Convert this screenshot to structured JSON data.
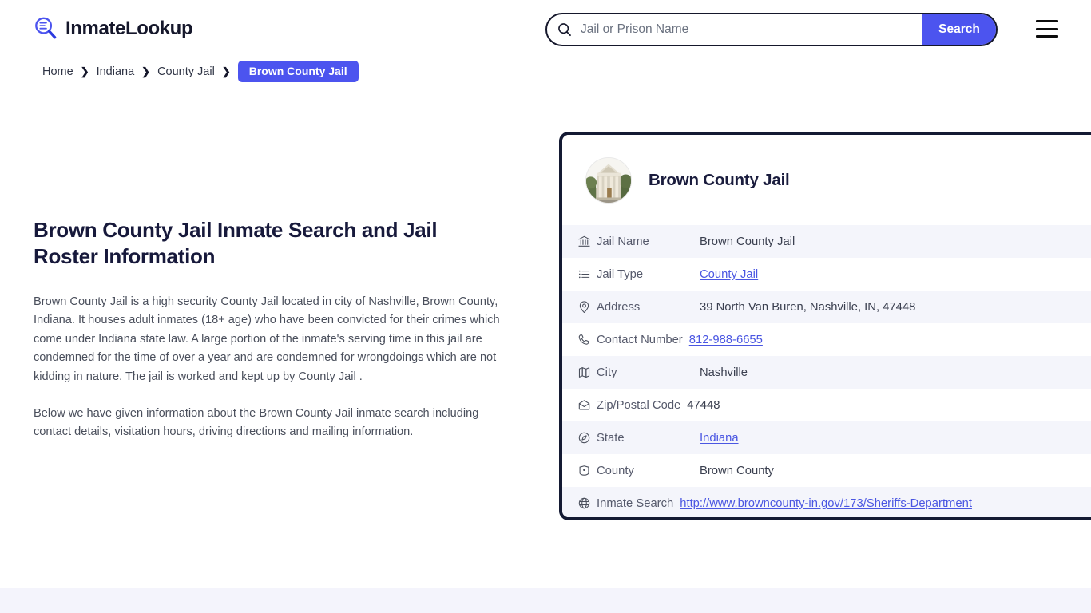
{
  "header": {
    "logo_text": "InmateLookup",
    "logo_icon": "magnifier-list-icon",
    "search": {
      "placeholder": "Jail or Prison Name",
      "value": "",
      "icon": "search-icon",
      "button_label": "Search"
    },
    "menu_icon": "hamburger-menu-icon"
  },
  "breadcrumb": {
    "items": [
      {
        "label": "Home",
        "current": false
      },
      {
        "label": "Indiana",
        "current": false
      },
      {
        "label": "County Jail",
        "current": false
      },
      {
        "label": "Brown County Jail",
        "current": true
      }
    ],
    "separator": "❯"
  },
  "main": {
    "title": "Brown County Jail Inmate Search and Jail Roster Information",
    "paragraphs": [
      "Brown County Jail is a high security County Jail located in city of Nashville, Brown County, Indiana. It houses adult inmates (18+ age) who have been convicted for their crimes which come under Indiana state law. A large portion of the inmate's serving time in this jail are condemned for the time of over a year and are condemned for wrongdoings which are not kidding in nature. The jail is worked and kept up by County Jail .",
      "Below we have given information about the Brown County Jail inmate search including contact details, visitation hours, driving directions and mailing information."
    ]
  },
  "card": {
    "avatar_icon": "courthouse-photo",
    "title": "Brown County Jail",
    "rows": [
      {
        "icon": "bank-icon",
        "label": "Jail Name",
        "value": "Brown County Jail",
        "link": false
      },
      {
        "icon": "list-icon",
        "label": "Jail Type",
        "value": "County Jail",
        "link": true
      },
      {
        "icon": "location-icon",
        "label": "Address",
        "value": "39 North Van Buren, Nashville, IN, 47448",
        "link": false
      },
      {
        "icon": "phone-icon",
        "label": "Contact Number",
        "value": "812-988-6655",
        "link": true
      },
      {
        "icon": "map-icon",
        "label": "City",
        "value": "Nashville",
        "link": false
      },
      {
        "icon": "envelope-icon",
        "label": "Zip/Postal Code",
        "value": "47448",
        "link": false
      },
      {
        "icon": "compass-icon",
        "label": "State",
        "value": "Indiana",
        "link": true
      },
      {
        "icon": "county-icon",
        "label": "County",
        "value": "Brown County",
        "link": false
      },
      {
        "icon": "globe-icon",
        "label": "Inmate Search",
        "value": "http://www.browncounty-in.gov/173/Sheriffs-Department",
        "link": true
      }
    ]
  },
  "colors": {
    "accent": "#4c54ef",
    "dark": "#15172b",
    "row_alt": "#f4f5fb",
    "link": "#4a56e2",
    "footer_band": "#f4f4fc"
  }
}
